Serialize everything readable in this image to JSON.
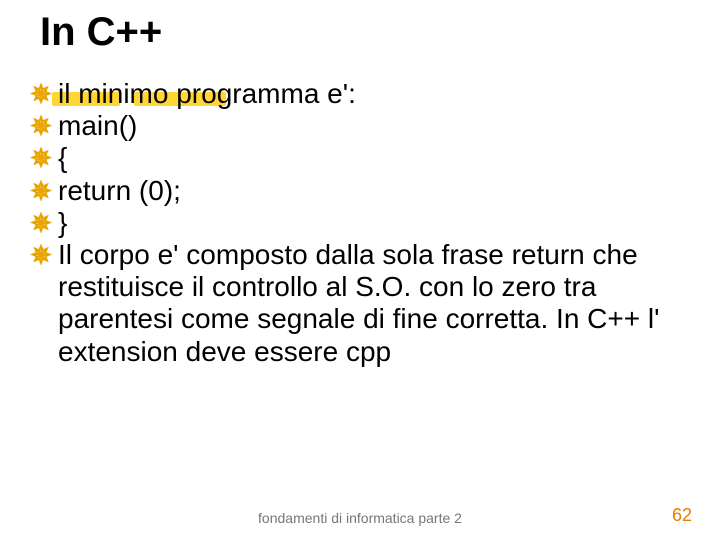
{
  "title": "In C++",
  "bullets": {
    "b0": "il minimo programma e':",
    "b1": "main()",
    "b2": "{",
    "b3": " return (0);",
    "b4": "}",
    "b5": "Il corpo e' composto dalla sola frase return che restituisce il controllo al S.O. con lo zero tra parentesi come segnale di fine corretta. In C++ l' extension deve essere cpp"
  },
  "footer": {
    "center": "fondamenti di informatica parte 2",
    "page": "62"
  },
  "glyphs": {
    "bullet": "✵"
  },
  "colors": {
    "bullet": "#e8a400",
    "pagenum": "#e67e00",
    "highlight": "#ffd633"
  }
}
